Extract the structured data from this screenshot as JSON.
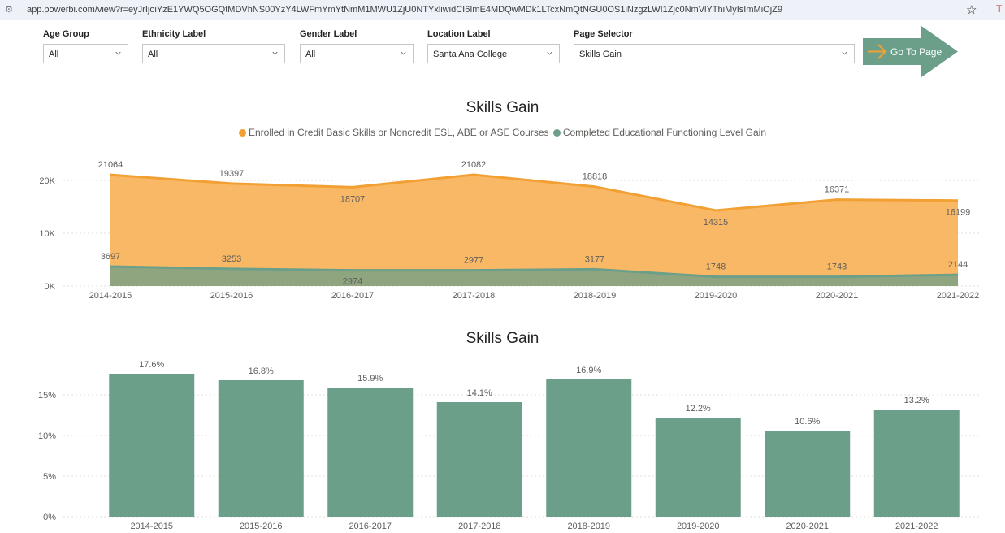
{
  "browser": {
    "url": "app.powerbi.com/view?r=eyJrIjoiYzE1YWQ5OGQtMDVhNS00YzY4LWFmYmYtNmM1MWU1ZjU0NTYxliwidCI6ImE4MDQwMDk1LTcxNmQtNGU0OS1iNzgzLWI1Zjc0NmVlYThiMyIsImMiOjZ9",
    "site_icon": "tune-icon",
    "bookmark_icon": "star-icon"
  },
  "filters": [
    {
      "label": "Age Group",
      "value": "All"
    },
    {
      "label": "Ethnicity Label",
      "value": "All"
    },
    {
      "label": "Gender Label",
      "value": "All"
    },
    {
      "label": "Location Label",
      "value": "Santa Ana College"
    },
    {
      "label": "Page Selector",
      "value": "Skills Gain"
    }
  ],
  "goto": {
    "label": "Go To Page",
    "color": "#6b9f8a",
    "arrow_color": "#f2a033"
  },
  "colors": {
    "orange": "#f2a033",
    "green": "#6b9f8a"
  },
  "chart_data": [
    {
      "type": "area",
      "title": "Skills Gain",
      "categories": [
        "2014-2015",
        "2015-2016",
        "2016-2017",
        "2017-2018",
        "2018-2019",
        "2019-2020",
        "2020-2021",
        "2021-2022"
      ],
      "series": [
        {
          "name": "Enrolled in Credit Basic Skills or Noncredit ESL, ABE or ASE Courses",
          "color": "#f2a033",
          "values": [
            21064,
            19397,
            18707,
            21082,
            18818,
            14315,
            16371,
            16199
          ]
        },
        {
          "name": "Completed Educational Functioning Level Gain",
          "color": "#6b9f8a",
          "values": [
            3697,
            3253,
            2974,
            2977,
            3177,
            1748,
            1743,
            2144
          ]
        }
      ],
      "yticks": [
        "0K",
        "10K",
        "20K"
      ],
      "ylim": [
        0,
        24000
      ],
      "legend": "top-center",
      "grid": true
    },
    {
      "type": "bar",
      "title": "Skills Gain",
      "categories": [
        "2014-2015",
        "2015-2016",
        "2016-2017",
        "2017-2018",
        "2018-2019",
        "2019-2020",
        "2020-2021",
        "2021-2022"
      ],
      "values": [
        17.6,
        16.8,
        15.9,
        14.1,
        16.9,
        12.2,
        10.6,
        13.2
      ],
      "labels": [
        "17.6%",
        "16.8%",
        "15.9%",
        "14.1%",
        "16.9%",
        "12.2%",
        "10.6%",
        "13.2%"
      ],
      "color": "#6b9f8a",
      "yticks": [
        "0%",
        "5%",
        "10%",
        "15%"
      ],
      "ylim": [
        0,
        20
      ],
      "grid": true
    }
  ]
}
